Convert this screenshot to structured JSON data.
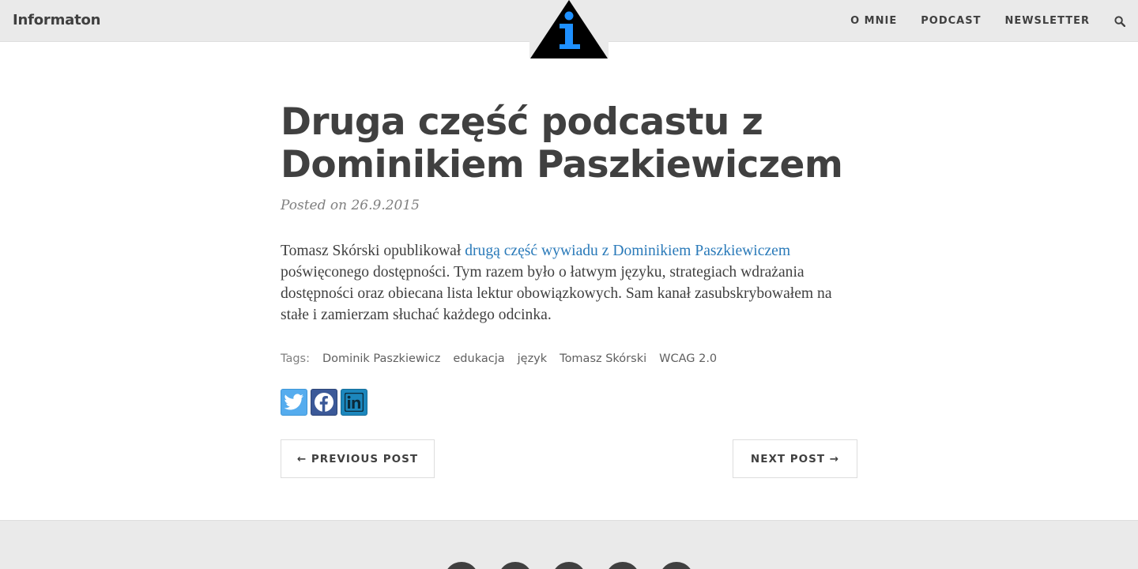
{
  "header": {
    "brand": "Informaton",
    "nav": [
      {
        "label": "O MNIE"
      },
      {
        "label": "PODCAST"
      },
      {
        "label": "NEWSLETTER"
      }
    ],
    "search_icon": "search-icon",
    "logo_icon": "information-triangle-logo"
  },
  "post": {
    "title": "Druga część podcastu z Dominikiem Paszkiewiczem",
    "meta": "Posted on 26.9.2015",
    "body_before_link": "Tomasz Skórski opublikował ",
    "link_text": "drugą część wywiadu z Dominikiem Paszkiewiczem",
    "body_after_link": " poświęconego dostępności. Tym razem było o łatwym języku, strategiach wdrażania dostępności oraz obiecana lista lektur obowiązkowych. Sam kanał zasubskrybowałem na stałe i zamierzam słuchać każdego odcinka.",
    "tags_label": "Tags:",
    "tags": [
      "Dominik Paszkiewicz",
      "edukacja",
      "język",
      "Tomasz Skórski",
      "WCAG 2.0"
    ],
    "share": [
      {
        "icon": "twitter-icon",
        "color": "#55acee"
      },
      {
        "icon": "facebook-icon",
        "color": "#3b5998"
      },
      {
        "icon": "linkedin-icon",
        "color": "#1c87bd"
      }
    ]
  },
  "pager": {
    "previous": "← PREVIOUS POST",
    "next": "NEXT POST →"
  },
  "colors": {
    "navbar_bg": "#eaeaea",
    "text": "#404040",
    "link": "#2a7ab9",
    "logo_accent": "#1e90ff"
  }
}
